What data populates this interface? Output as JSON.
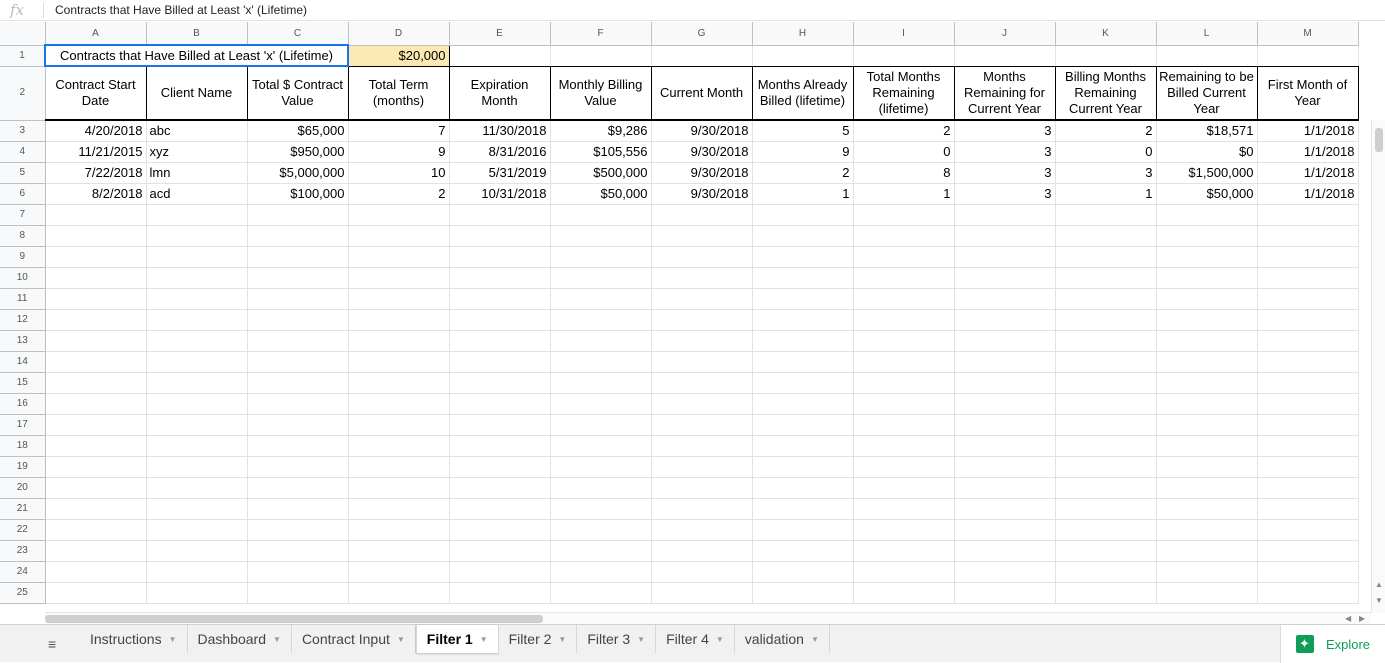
{
  "formula_bar": {
    "icon": "fx",
    "text": "Contracts that Have Billed at Least 'x' (Lifetime)"
  },
  "columns": [
    "A",
    "B",
    "C",
    "D",
    "E",
    "F",
    "G",
    "H",
    "I",
    "J",
    "K",
    "L",
    "M"
  ],
  "rows": [
    "1",
    "2",
    "3",
    "4",
    "5",
    "6",
    "7",
    "8",
    "9",
    "10",
    "11",
    "12",
    "13",
    "14",
    "15",
    "16",
    "17",
    "18",
    "19",
    "20",
    "21",
    "22",
    "23",
    "24",
    "25"
  ],
  "row1": {
    "title": "Contracts that Have Billed at Least 'x' (Lifetime)",
    "threshold": "$20,000"
  },
  "headers": [
    "Contract Start Date",
    "Client Name",
    "Total $ Contract Value",
    "Total Term (months)",
    "Expiration Month",
    "Monthly Billing Value",
    "Current Month",
    "Months Already Billed (lifetime)",
    "Total Months Remaining (lifetime)",
    "Months Remaining for Current Year",
    "Billing Months Remaining Current Year",
    "Remaining to be Billed Current Year",
    "First Month of Year"
  ],
  "data_rows": [
    [
      "4/20/2018",
      "abc",
      "$65,000",
      "7",
      "11/30/2018",
      "$9,286",
      "9/30/2018",
      "5",
      "2",
      "3",
      "2",
      "$18,571",
      "1/1/2018"
    ],
    [
      "11/21/2015",
      "xyz",
      "$950,000",
      "9",
      "8/31/2016",
      "$105,556",
      "9/30/2018",
      "9",
      "0",
      "3",
      "0",
      "$0",
      "1/1/2018"
    ],
    [
      "7/22/2018",
      "lmn",
      "$5,000,000",
      "10",
      "5/31/2019",
      "$500,000",
      "9/30/2018",
      "2",
      "8",
      "3",
      "3",
      "$1,500,000",
      "1/1/2018"
    ],
    [
      "8/2/2018",
      "acd",
      "$100,000",
      "2",
      "10/31/2018",
      "$50,000",
      "9/30/2018",
      "1",
      "1",
      "3",
      "1",
      "$50,000",
      "1/1/2018"
    ]
  ],
  "sheet_tabs": [
    {
      "label": "Instructions",
      "active": false
    },
    {
      "label": "Dashboard",
      "active": false
    },
    {
      "label": "Contract Input",
      "active": false
    },
    {
      "label": "Filter 1",
      "active": true
    },
    {
      "label": "Filter 2",
      "active": false
    },
    {
      "label": "Filter 3",
      "active": false
    },
    {
      "label": "Filter 4",
      "active": false
    },
    {
      "label": "validation",
      "active": false
    }
  ],
  "explore_label": "Explore",
  "colors": {
    "selection": "#1a73e8",
    "highlight_fill": "#fce8b2",
    "explore_green": "#0f9d58"
  }
}
